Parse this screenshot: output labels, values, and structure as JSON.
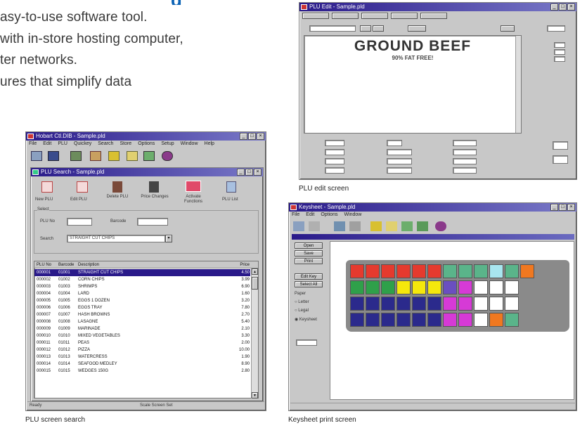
{
  "intro": {
    "heading_fragment": "g",
    "lines": [
      "asy-to-use software tool.",
      "with in-store hosting computer,",
      "ter networks.",
      "ures that simplify data"
    ]
  },
  "captions": {
    "plu_search": "PLU screen search",
    "plu_edit": "PLU edit screen",
    "keysheet": "Keysheet print screen"
  },
  "edit_screen": {
    "title": "PLU Edit - Sample.pld",
    "label_line1": "GROUND BEEF",
    "label_line2": "90% FAT FREE!"
  },
  "search_screen": {
    "app_title": "Hobart Ctl.DIB - Sample.pld",
    "menu": [
      "File",
      "Edit",
      "PLU",
      "Quickey",
      "Search",
      "Store",
      "Options",
      "Setup",
      "Window",
      "Help"
    ],
    "child_title": "PLU Search - Sample.pld",
    "toolbar": [
      "New PLU",
      "Edit PLU",
      "Delete PLU",
      "Price Changes",
      "Activate Functions",
      "PLU List"
    ],
    "group_label": "Select",
    "plu_no_label": "PLU No",
    "barcode_label": "Barcode",
    "search_label": "Search",
    "search_value": "STRAIGHT CUT CHIPS",
    "columns": [
      "PLU No",
      "Barcode",
      "Description",
      "Price"
    ],
    "rows": [
      [
        "000001",
        "01001",
        "STRAIGHT CUT CHIPS",
        "4.50"
      ],
      [
        "000002",
        "01002",
        "CORN CHIPS",
        "3.99"
      ],
      [
        "000003",
        "01003",
        "SHRIMPS",
        "6.90"
      ],
      [
        "000004",
        "01004",
        "LARD",
        "1.60"
      ],
      [
        "000005",
        "01005",
        "EGGS 1 DOZEN",
        "3.20"
      ],
      [
        "000006",
        "01006",
        "EGGS TRAY",
        "7.80"
      ],
      [
        "000007",
        "01007",
        "HASH BROWNS",
        "2.70"
      ],
      [
        "000008",
        "01008",
        "LASAGNE",
        "5.40"
      ],
      [
        "000009",
        "01009",
        "MARINADE",
        "2.10"
      ],
      [
        "000010",
        "01010",
        "MIXED VEGETABLES",
        "3.30"
      ],
      [
        "000011",
        "01011",
        "PEAS",
        "2.00"
      ],
      [
        "000012",
        "01012",
        "PIZZA",
        "10.00"
      ],
      [
        "000013",
        "01013",
        "WATERCRESS",
        "1.90"
      ],
      [
        "000014",
        "01014",
        "SEAFOOD MEDLEY",
        "8.90"
      ],
      [
        "000015",
        "01015",
        "WEDGES 150G",
        "2.80"
      ]
    ],
    "status": "Ready",
    "status_right": "Scale Screen Set"
  },
  "keysheet_screen": {
    "title": "Keysheet - Sample.pld",
    "menu": [
      "File",
      "Edit",
      "Options",
      "Window"
    ],
    "side_buttons": [
      "Open",
      "Save",
      "Print",
      "Edit Key",
      "Select All"
    ],
    "group_label": "Paper",
    "radio_options": [
      "Letter",
      "Legal",
      "Keysheet"
    ],
    "key_colors": {
      "red": "#e53a2e",
      "green": "#2fa04a",
      "yellow": "#f5e80c",
      "navy": "#2b2a8c",
      "magenta": "#d63ad6",
      "orange": "#f07820",
      "teal": "#5ab48a",
      "cyan": "#a8e6f0",
      "purple": "#6a4fc0"
    }
  }
}
